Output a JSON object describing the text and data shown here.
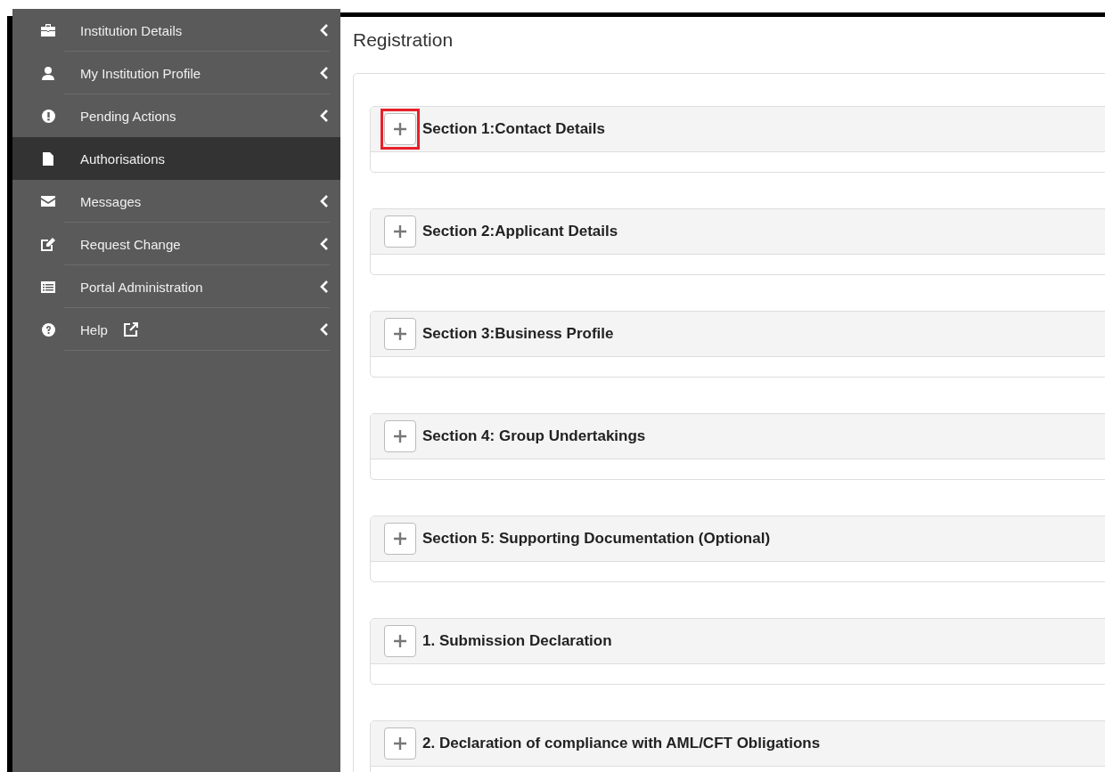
{
  "sidebar": {
    "items": [
      {
        "label": "Institution Details",
        "selected": false,
        "has_submenu": true,
        "external": false
      },
      {
        "label": "My Institution Profile",
        "selected": false,
        "has_submenu": true,
        "external": false
      },
      {
        "label": "Pending Actions",
        "selected": false,
        "has_submenu": true,
        "external": false
      },
      {
        "label": "Authorisations",
        "selected": true,
        "has_submenu": false,
        "external": false
      },
      {
        "label": "Messages",
        "selected": false,
        "has_submenu": true,
        "external": false
      },
      {
        "label": "Request Change",
        "selected": false,
        "has_submenu": true,
        "external": false
      },
      {
        "label": "Portal Administration",
        "selected": false,
        "has_submenu": true,
        "external": false
      },
      {
        "label": "Help",
        "selected": false,
        "has_submenu": true,
        "external": true
      }
    ]
  },
  "page": {
    "title": "Registration"
  },
  "sections": [
    {
      "title": "Section 1:Contact Details",
      "highlighted": true
    },
    {
      "title": "Section 2:Applicant Details",
      "highlighted": false
    },
    {
      "title": "Section 3:Business Profile",
      "highlighted": false
    },
    {
      "title": "Section 4: Group Undertakings",
      "highlighted": false
    },
    {
      "title": "Section 5: Supporting Documentation (Optional)",
      "highlighted": false
    },
    {
      "title": "1. Submission Declaration",
      "highlighted": false
    },
    {
      "title": "2. Declaration of compliance with AML/CFT Obligations",
      "highlighted": false
    }
  ]
}
